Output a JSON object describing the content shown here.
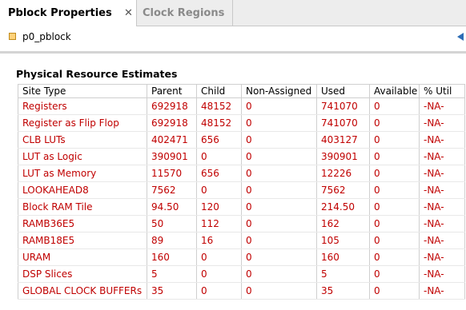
{
  "tabs": [
    {
      "label": "Pblock Properties",
      "active": true
    },
    {
      "label": "Clock Regions",
      "active": false
    }
  ],
  "object": {
    "name": "p0_pblock"
  },
  "section": {
    "title": "Physical Resource Estimates"
  },
  "table": {
    "columns": [
      "Site Type",
      "Parent",
      "Child",
      "Non-Assigned",
      "Used",
      "Available",
      "% Util"
    ],
    "rows": [
      [
        "Registers",
        "692918",
        "48152",
        "0",
        "741070",
        "0",
        "-NA-"
      ],
      [
        "Register as Flip Flop",
        "692918",
        "48152",
        "0",
        "741070",
        "0",
        "-NA-"
      ],
      [
        "CLB LUTs",
        "402471",
        "656",
        "0",
        "403127",
        "0",
        "-NA-"
      ],
      [
        "LUT as Logic",
        "390901",
        "0",
        "0",
        "390901",
        "0",
        "-NA-"
      ],
      [
        "LUT as Memory",
        "11570",
        "656",
        "0",
        "12226",
        "0",
        "-NA-"
      ],
      [
        "LOOKAHEAD8",
        "7562",
        "0",
        "0",
        "7562",
        "0",
        "-NA-"
      ],
      [
        "Block RAM Tile",
        "94.50",
        "120",
        "0",
        "214.50",
        "0",
        "-NA-"
      ],
      [
        "RAMB36E5",
        "50",
        "112",
        "0",
        "162",
        "0",
        "-NA-"
      ],
      [
        "RAMB18E5",
        "89",
        "16",
        "0",
        "105",
        "0",
        "-NA-"
      ],
      [
        "URAM",
        "160",
        "0",
        "0",
        "160",
        "0",
        "-NA-"
      ],
      [
        "DSP Slices",
        "5",
        "0",
        "0",
        "5",
        "0",
        "-NA-"
      ],
      [
        "GLOBAL CLOCK BUFFERs",
        "35",
        "0",
        "0",
        "35",
        "0",
        "-NA-"
      ]
    ]
  },
  "colors": {
    "value_text": "#c00000",
    "object_icon": "#ffd27a",
    "nav_arrow": "#2d6cb5"
  },
  "icons": {
    "close": "close-icon",
    "object": "pblock-icon",
    "back": "back-arrow-icon"
  }
}
